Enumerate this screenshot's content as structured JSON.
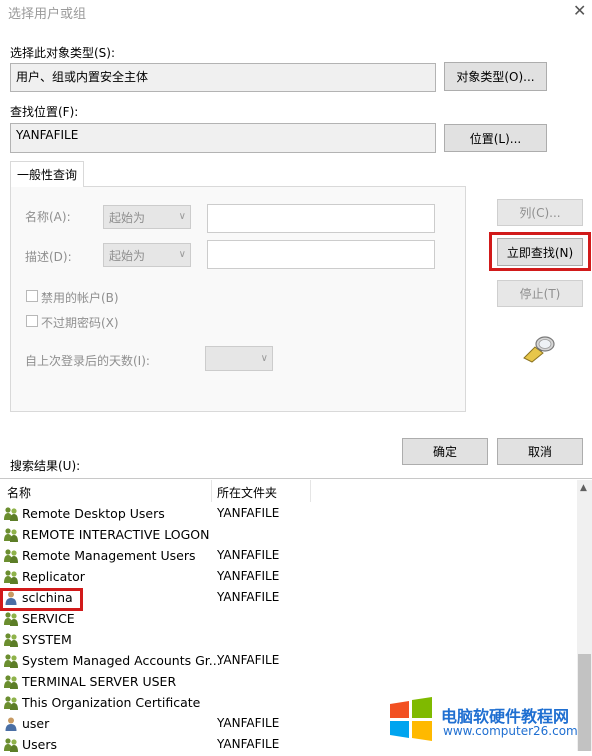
{
  "window": {
    "title": "选择用户或组",
    "close_symbol": "✕"
  },
  "object_types": {
    "label": "选择此对象类型(S):",
    "value": "用户、组或内置安全主体",
    "button": "对象类型(O)..."
  },
  "location": {
    "label": "查找位置(F):",
    "value": "YANFAFILE",
    "button": "位置(L)..."
  },
  "query": {
    "tab": "一般性查询",
    "name_label": "名称(A):",
    "name_mode": "起始为",
    "desc_label": "描述(D):",
    "desc_mode": "起始为",
    "disabled_accounts": "禁用的帐户(B)",
    "non_expiring_pw": "不过期密码(X)",
    "days_since_logon": "自上次登录后的天数(I):"
  },
  "buttons": {
    "columns": "列(C)...",
    "find_now": "立即查找(N)",
    "stop": "停止(T)",
    "ok": "确定",
    "cancel": "取消"
  },
  "results": {
    "label": "搜索结果(U):",
    "col_name": "名称",
    "col_folder": "所在文件夹",
    "rows": [
      {
        "name": "Remote Desktop Users",
        "folder": "YANFAFILE",
        "icon": "group-icon"
      },
      {
        "name": "REMOTE INTERACTIVE LOGON",
        "folder": "",
        "icon": "group-icon"
      },
      {
        "name": "Remote Management Users",
        "folder": "YANFAFILE",
        "icon": "group-icon"
      },
      {
        "name": "Replicator",
        "folder": "YANFAFILE",
        "icon": "group-icon"
      },
      {
        "name": "sclchina",
        "folder": "YANFAFILE",
        "icon": "user-icon"
      },
      {
        "name": "SERVICE",
        "folder": "",
        "icon": "group-icon"
      },
      {
        "name": "SYSTEM",
        "folder": "",
        "icon": "group-icon"
      },
      {
        "name": "System Managed Accounts Gr...",
        "folder": "YANFAFILE",
        "icon": "group-icon"
      },
      {
        "name": "TERMINAL SERVER USER",
        "folder": "",
        "icon": "group-icon"
      },
      {
        "name": "This Organization Certificate",
        "folder": "",
        "icon": "group-icon"
      },
      {
        "name": "user",
        "folder": "YANFAFILE",
        "icon": "user-icon"
      },
      {
        "name": "Users",
        "folder": "YANFAFILE",
        "icon": "group-icon"
      }
    ]
  },
  "watermark": {
    "text": "电脑软硬件教程网",
    "url": "www.computer26.com"
  },
  "colors": {
    "highlight": "#d11a1a",
    "brand": "#1f6fd1"
  }
}
